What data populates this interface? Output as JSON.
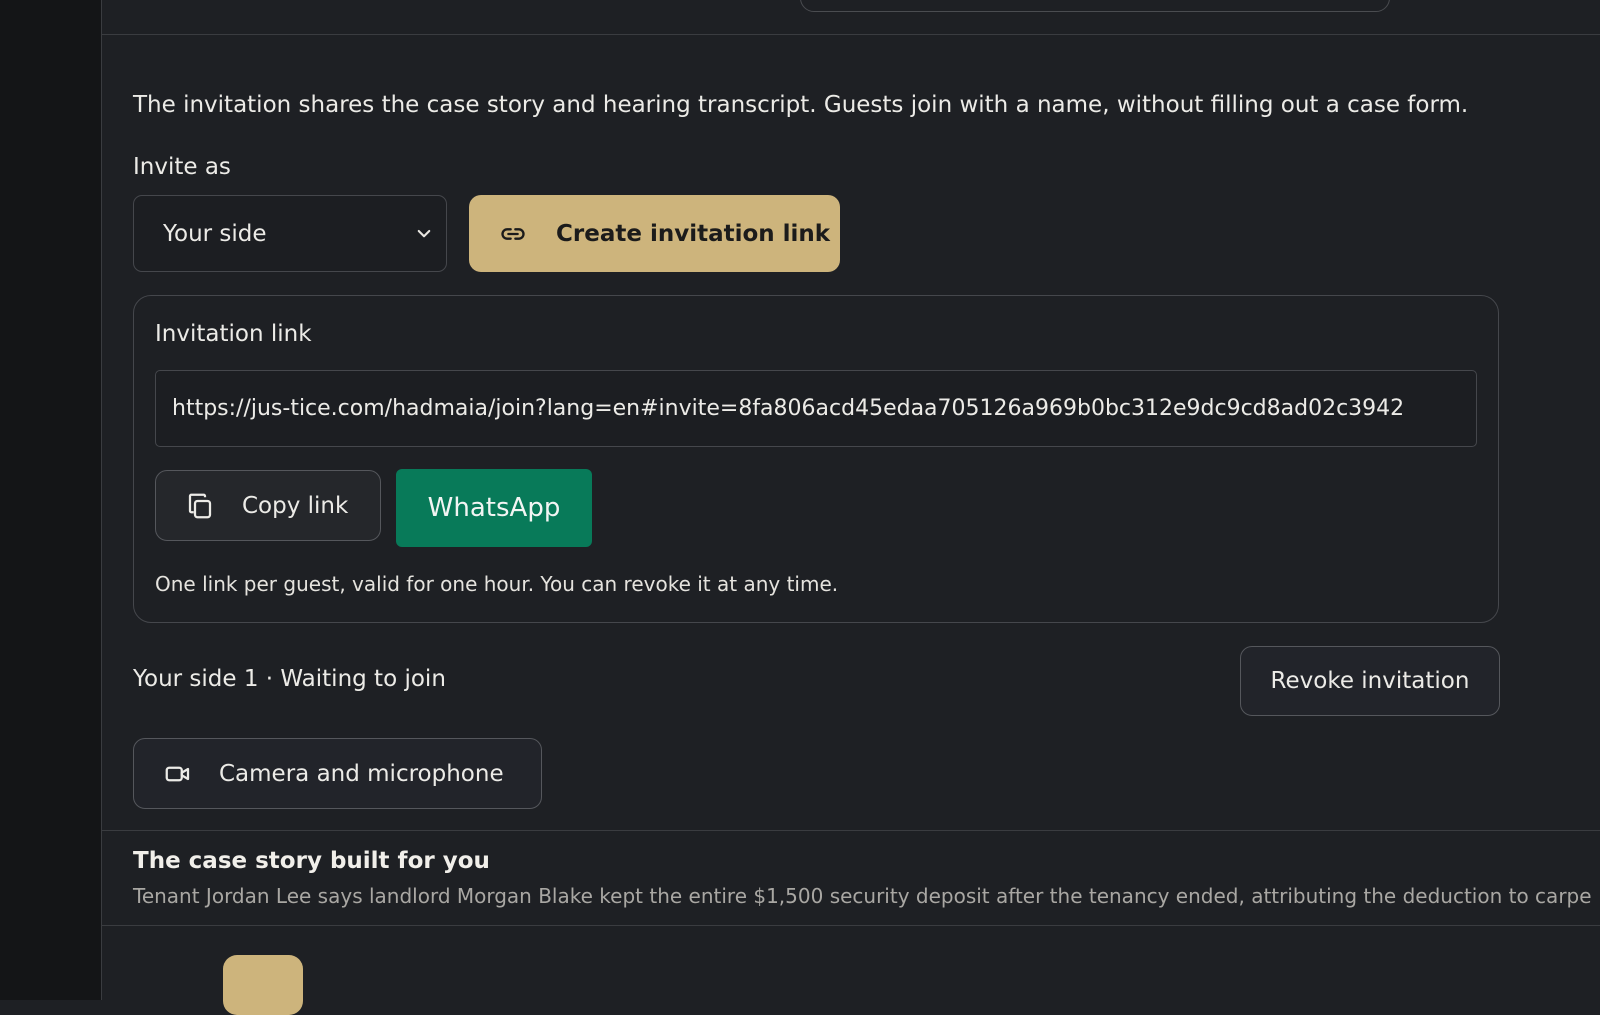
{
  "invite": {
    "intro": "The invitation shares the case story and hearing transcript. Guests join with a name, without filling out a case form.",
    "invite_as_label": "Invite as",
    "role_selected": "Your side",
    "create_button": "Create invitation link"
  },
  "link_panel": {
    "title": "Invitation link",
    "url": "https://jus-tice.com/hadmaia/join?lang=en#invite=8fa806acd45edaa705126a969b0bc312e9dc9cd8ad02c3942",
    "copy_button": "Copy link",
    "whatsapp_button": "WhatsApp",
    "note": "One link per guest, valid for one hour. You can revoke it at any time."
  },
  "guest": {
    "status": "Your side 1 · Waiting to join",
    "revoke_button": "Revoke invitation",
    "camera_button": "Camera and microphone"
  },
  "story": {
    "title": "The case story built for you",
    "text": "Tenant Jordan Lee says landlord Morgan Blake kept the entire $1,500 security deposit after the tenancy ended, attributing the deduction to carpe"
  },
  "colors": {
    "accent": "#cdb47c",
    "whatsapp": "#087a59",
    "background": "#1e2024"
  },
  "icons": {
    "create": "link-icon",
    "copy": "copy-icon",
    "camera": "video-camera-icon",
    "select": "chevron-down-icon"
  }
}
